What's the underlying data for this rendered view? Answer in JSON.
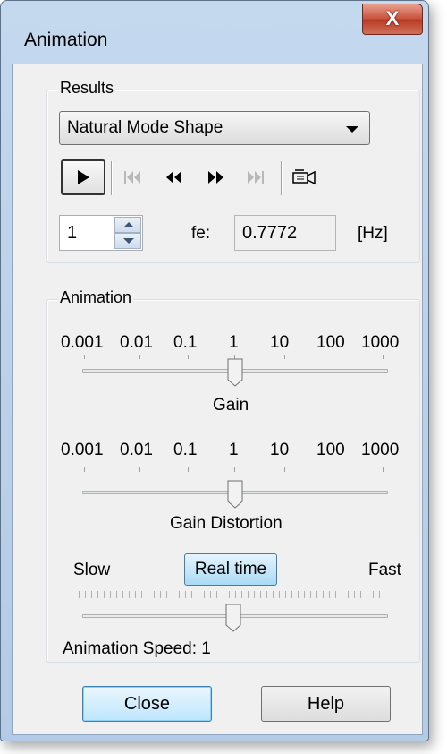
{
  "window": {
    "title": "Animation",
    "close_symbol": "X"
  },
  "results": {
    "group_label": "Results",
    "dropdown_value": "Natural Mode Shape",
    "toolbar": {
      "play_icon": "play-icon",
      "first_icon": "skip-to-start-icon",
      "back_icon": "step-back-icon",
      "forward_icon": "step-forward-icon",
      "last_icon": "skip-to-end-icon",
      "camera_icon": "video-camera-icon"
    },
    "mode_number": "1",
    "freq_label": "fe:",
    "freq_value": "0.7772",
    "freq_unit": "[Hz]"
  },
  "animation": {
    "group_label": "Animation",
    "gain": {
      "ticks": [
        "0.001",
        "0.01",
        "0.1",
        "1",
        "10",
        "100",
        "1000"
      ],
      "label": "Gain",
      "value": "1"
    },
    "gain_distortion": {
      "ticks": [
        "0.001",
        "0.01",
        "0.1",
        "1",
        "10",
        "100",
        "1000"
      ],
      "label": "Gain Distortion",
      "value": "1"
    },
    "speed": {
      "slow_label": "Slow",
      "realtime_label": "Real time",
      "fast_label": "Fast",
      "status_text": "Animation Speed: 1"
    }
  },
  "buttons": {
    "close_label": "Close",
    "help_label": "Help"
  },
  "colors": {
    "title_bar": "#b9cfe8",
    "close_button": "#c8503a",
    "realtime_button": "#a9daf4",
    "default_button": "#bee6fd"
  }
}
